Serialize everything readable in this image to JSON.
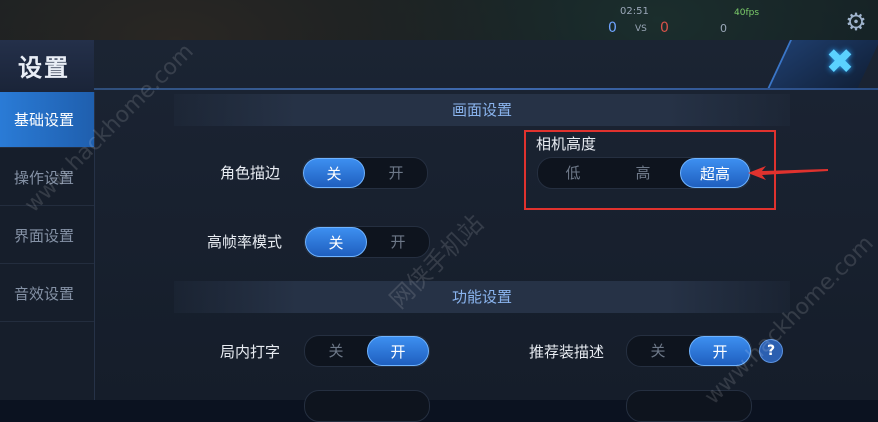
{
  "hud": {
    "timer": "02:51",
    "score_blue": "0",
    "vs": "VS",
    "score_red": "0",
    "fps": "40fps",
    "ping": "0"
  },
  "window": {
    "title": "设置",
    "close_icon": "close-x-icon"
  },
  "sidebar": {
    "items": [
      {
        "label": "基础设置",
        "active": true
      },
      {
        "label": "操作设置",
        "active": false
      },
      {
        "label": "界面设置",
        "active": false
      },
      {
        "label": "音效设置",
        "active": false
      }
    ]
  },
  "sections": {
    "display": "画面设置",
    "function": "功能设置"
  },
  "settings": {
    "outline": {
      "label": "角色描边",
      "off": "关",
      "on": "开",
      "value": "关"
    },
    "high_fps": {
      "label": "高帧率模式",
      "off": "关",
      "on": "开",
      "value": "关"
    },
    "camera": {
      "label": "相机高度",
      "options": [
        "低",
        "高",
        "超高"
      ],
      "value": "超高"
    },
    "in_game_typing": {
      "label": "局内打字",
      "off": "关",
      "on": "开",
      "value": "开"
    },
    "item_desc": {
      "label": "推荐装描述",
      "off": "关",
      "on": "开",
      "value": "开"
    },
    "help_icon": "?"
  },
  "watermarks": {
    "left": "www.hackhome.com",
    "center": "网侠手机站",
    "right": "www.hackhome.com"
  },
  "colors": {
    "accent": "#2a7bd6",
    "highlight_border": "#e0322e",
    "close_glow": "#5bd2ff"
  }
}
